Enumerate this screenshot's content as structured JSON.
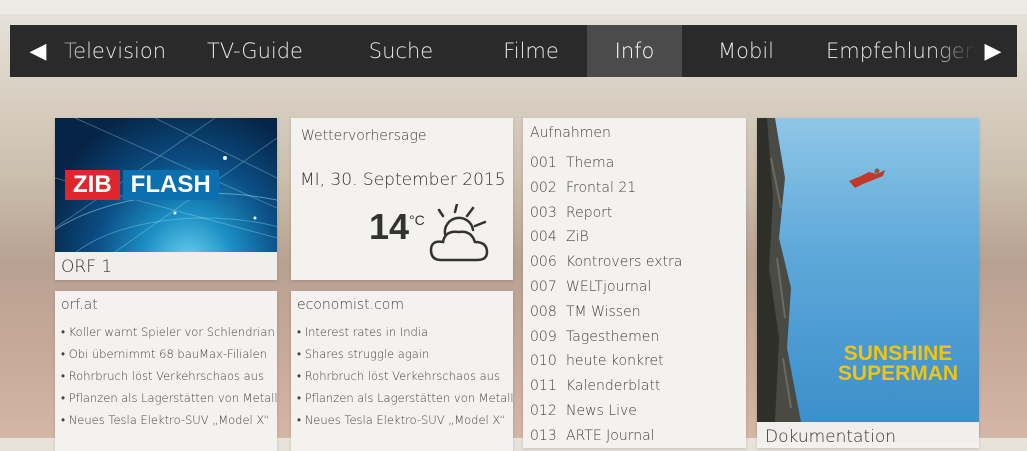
{
  "nav": {
    "items": [
      "Television",
      "TV-Guide",
      "Suche",
      "Filme",
      "Info",
      "Mobil",
      "Empfehlungen"
    ],
    "active": "Info"
  },
  "zib": {
    "logo_left": "ZIB",
    "logo_right": "FLASH",
    "caption": "ORF 1"
  },
  "weather": {
    "title": "Wettervorhersage",
    "date": "MI, 30. September 2015",
    "temperature": "14",
    "unit": "°C",
    "icon": "partly-cloudy-icon"
  },
  "news1": {
    "source": "orf.at",
    "items": [
      "Koller warnt Spieler vor Schlendrian",
      "Obi übernimmt 68 bauMax-Filialen",
      "Rohrbruch löst Verkehrschaos aus",
      "Pflanzen als Lagerstätten von Metall",
      "Neues Tesla Elektro-SUV „Model X“"
    ]
  },
  "news2": {
    "source": "economist.com",
    "items": [
      "Interest rates in India",
      "Shares struggle again",
      "Rohrbruch löst Verkehrschaos aus",
      "Pflanzen als Lagerstätten von Metall",
      "Neues Tesla Elektro-SUV „Model X“"
    ]
  },
  "recordings": {
    "title": "Aufnahmen",
    "items": [
      {
        "num": "001",
        "name": "Thema"
      },
      {
        "num": "002",
        "name": "Frontal 21"
      },
      {
        "num": "003",
        "name": "Report"
      },
      {
        "num": "004",
        "name": "ZiB"
      },
      {
        "num": "006",
        "name": "Kontrovers extra"
      },
      {
        "num": "007",
        "name": "WELTjournal"
      },
      {
        "num": "008",
        "name": "TM Wissen"
      },
      {
        "num": "009",
        "name": "Tagesthemen"
      },
      {
        "num": "010",
        "name": "heute konkret"
      },
      {
        "num": "011",
        "name": "Kalenderblatt"
      },
      {
        "num": "012",
        "name": "News Live"
      },
      {
        "num": "013",
        "name": "ARTE Journal"
      }
    ]
  },
  "poster": {
    "title_line1": "SUNSHINE",
    "title_line2": "SUPERMAN",
    "caption": "Dokumentation"
  },
  "colors": {
    "nav_bg": "#2a2a2a",
    "nav_active": "#4b4b4b",
    "zib_red": "#e0262d",
    "zib_blue": "#0b6fb0",
    "poster_title": "#f1c40f"
  }
}
